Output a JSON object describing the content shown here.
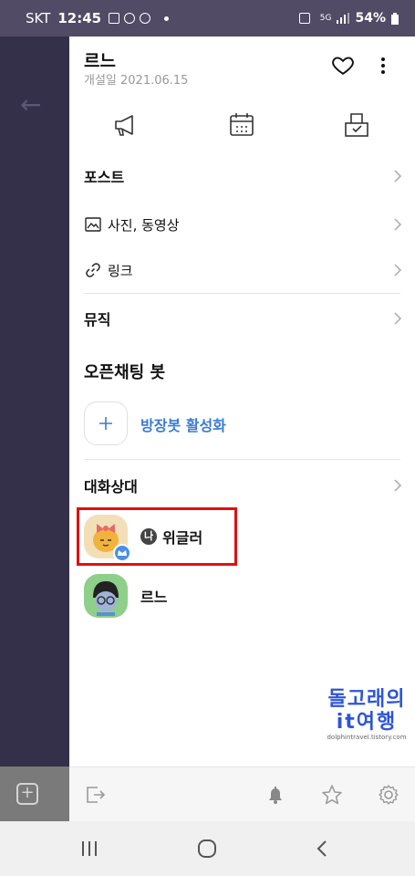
{
  "status_bar": {
    "carrier": "SKT",
    "time": "12:45",
    "battery": "54%",
    "network": "5G"
  },
  "header": {
    "title": "르느",
    "subtitle": "개설일 2021.06.15"
  },
  "icons": {
    "notice": "megaphone-icon",
    "calendar": "calendar-icon",
    "vote": "ballot-box-icon"
  },
  "menu": {
    "posts": "포스트",
    "photos": "사진, 동영상",
    "links": "링크",
    "music": "뮤직"
  },
  "bot_section": {
    "title": "오픈채팅 봇",
    "activate_label": "방장봇 활성화"
  },
  "members_section": {
    "title": "대화상대",
    "members": [
      {
        "badge": "나",
        "name": "위글러",
        "is_host": true
      },
      {
        "name": "르느",
        "is_host": false
      }
    ]
  },
  "watermark": {
    "line1": "돌고래의",
    "line2": "it여행",
    "url": "dolphintravel.tistory.com"
  },
  "colors": {
    "accent": "#3a7bd5",
    "highlight": "#e01010",
    "status_bg": "#514b66"
  }
}
